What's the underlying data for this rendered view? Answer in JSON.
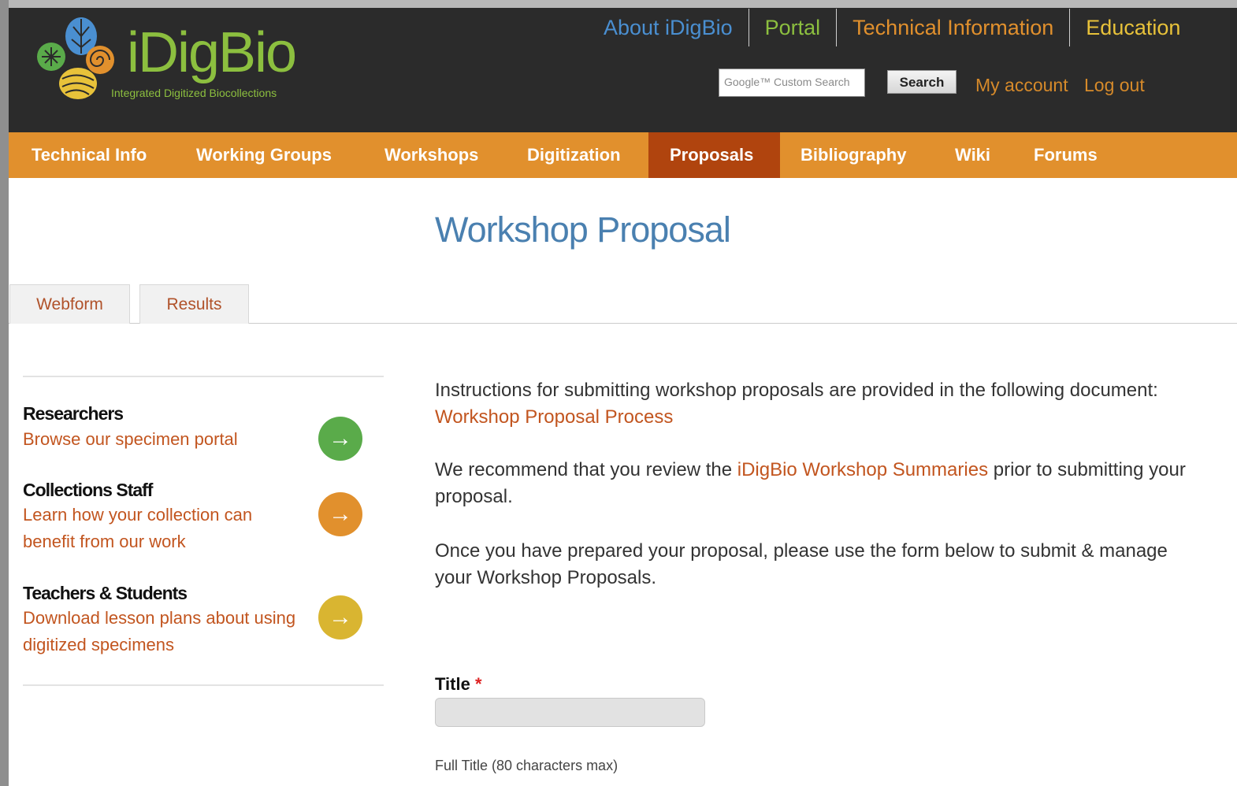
{
  "header": {
    "logo_text": "iDigBio",
    "logo_tagline": "Integrated Digitized Biocollections",
    "top_nav": [
      {
        "label": "About iDigBio",
        "color": "#4a8fd1"
      },
      {
        "label": "Portal",
        "color": "#8cbf3f"
      },
      {
        "label": "Technical Information",
        "color": "#e1902d"
      },
      {
        "label": "Education",
        "color": "#e8c23a"
      }
    ],
    "search_placeholder": "Google™ Custom Search",
    "search_button": "Search",
    "my_account": "My account",
    "log_out": "Log out"
  },
  "main_nav": [
    {
      "label": "Technical Info",
      "active": false
    },
    {
      "label": "Working Groups",
      "active": false
    },
    {
      "label": "Workshops",
      "active": false
    },
    {
      "label": "Digitization",
      "active": false
    },
    {
      "label": "Proposals",
      "active": true
    },
    {
      "label": "Bibliography",
      "active": false
    },
    {
      "label": "Wiki",
      "active": false
    },
    {
      "label": "Forums",
      "active": false
    }
  ],
  "page": {
    "title": "Workshop Proposal",
    "tabs": [
      "Webform",
      "Results"
    ]
  },
  "sidebar": [
    {
      "heading": "Researchers",
      "link": "Browse our specimen portal",
      "color": "#5aab4a"
    },
    {
      "heading": "Collections Staff",
      "link": "Learn how your collection can benefit from our work",
      "color": "#e1902d"
    },
    {
      "heading": "Teachers & Students",
      "link": "Download lesson plans about using digitized specimens",
      "color": "#d9b531"
    }
  ],
  "content": {
    "p1_text": "Instructions for submitting workshop proposals are provided in the following document: ",
    "p1_link": "Workshop Proposal Process",
    "p2_before": "We recommend that you review the ",
    "p2_link": "iDigBio Workshop Summaries",
    "p2_after": " prior to submitting your proposal.",
    "p3_text": "Once you have prepared your proposal, please use the form below to submit & manage your Workshop Proposals."
  },
  "form": {
    "title_label": "Title",
    "required_mark": "*",
    "title_value": "",
    "title_description": "Full Title (80 characters max)"
  },
  "colors": {
    "header_bg": "#2b2b2b",
    "nav_bg": "#e1902d",
    "nav_active_bg": "#b0440e",
    "link": "#c2551f",
    "title": "#4a80b0"
  }
}
